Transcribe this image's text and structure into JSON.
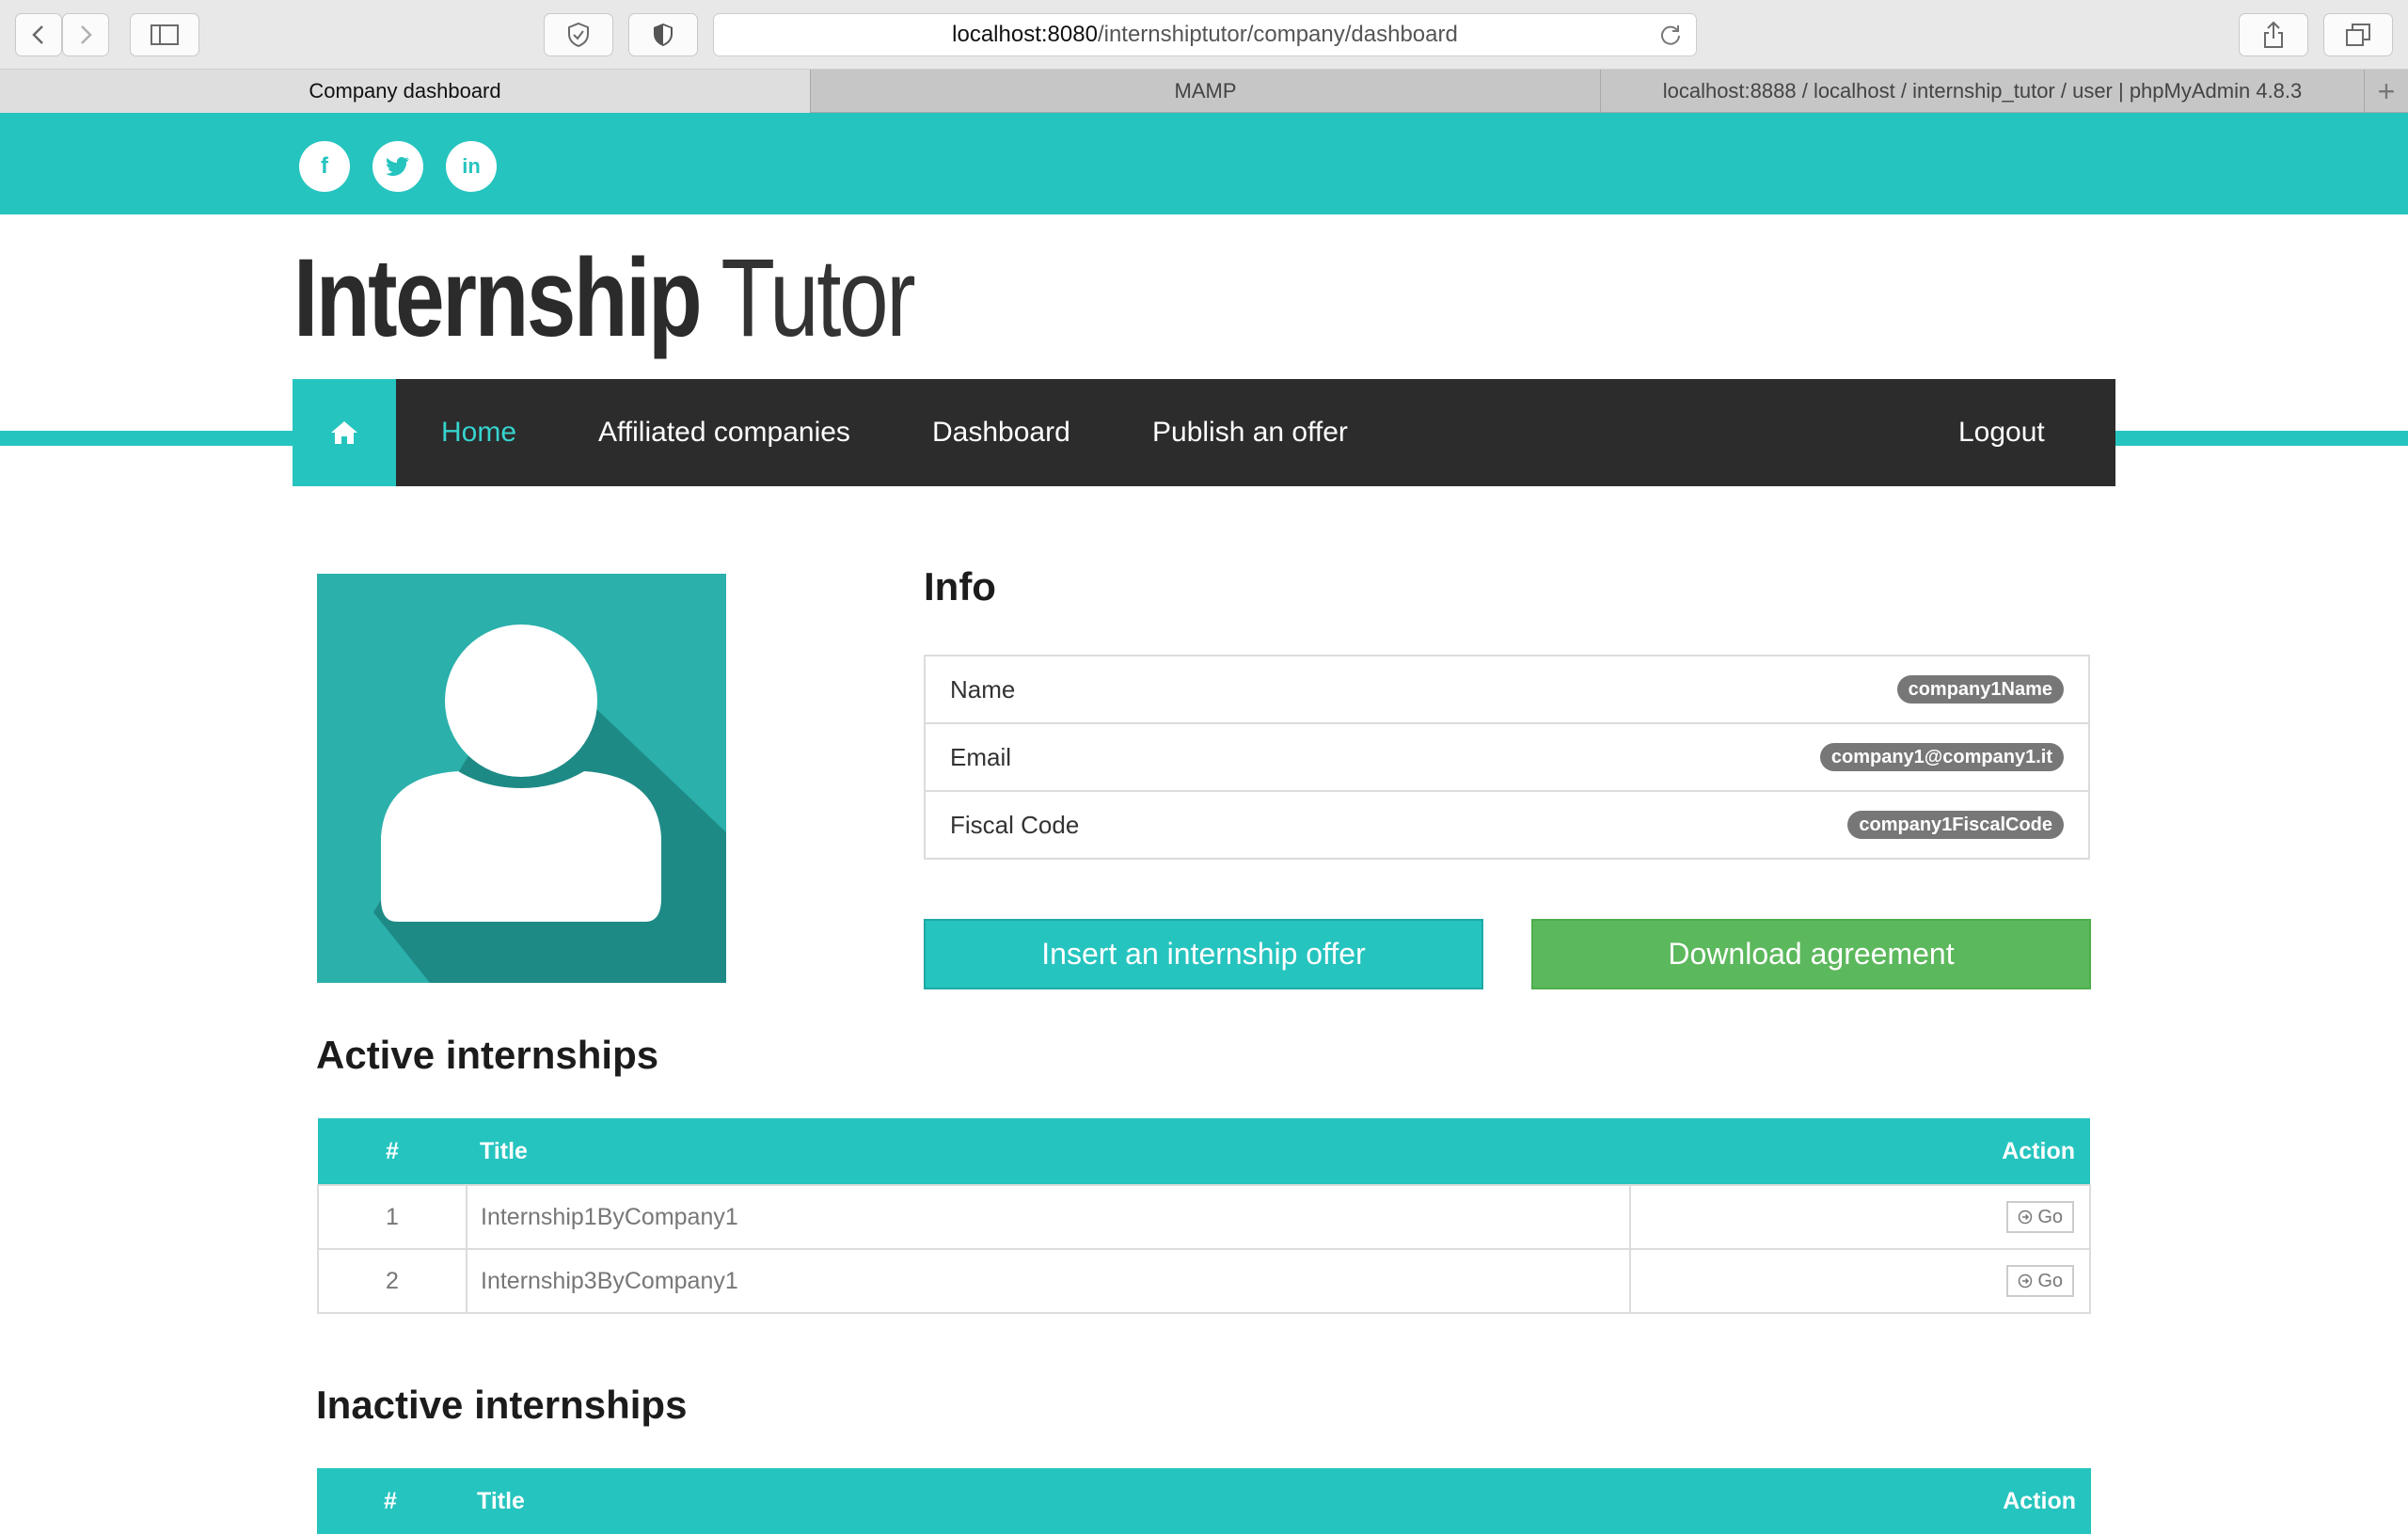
{
  "browser": {
    "url_host": "localhost:8080",
    "url_path": "/internshiptutor/company/dashboard",
    "tabs": [
      {
        "label": "Company dashboard"
      },
      {
        "label": "MAMP"
      },
      {
        "label": "localhost:8888 / localhost / internship_tutor / user | phpMyAdmin 4.8.3"
      }
    ],
    "new_tab_label": "+"
  },
  "social": {
    "facebook": "f",
    "twitter": "t",
    "linkedin": "in"
  },
  "logo": {
    "bold": "Internship",
    "light": "Tutor"
  },
  "nav": {
    "home_icon": "home-icon",
    "items": [
      {
        "label": "Home"
      },
      {
        "label": "Affiliated companies"
      },
      {
        "label": "Dashboard"
      },
      {
        "label": "Publish an offer"
      }
    ],
    "logout": "Logout"
  },
  "info": {
    "title": "Info",
    "rows": [
      {
        "label": "Name",
        "value": "company1Name"
      },
      {
        "label": "Email",
        "value": "company1@company1.it"
      },
      {
        "label": "Fiscal Code",
        "value": "company1FiscalCode"
      }
    ]
  },
  "actions": {
    "insert": "Insert an internship offer",
    "download": "Download agreement"
  },
  "active": {
    "title": "Active internships",
    "headers": {
      "num": "#",
      "title": "Title",
      "action": "Action"
    },
    "rows": [
      {
        "num": "1",
        "title": "Internship1ByCompany1",
        "action": "Go"
      },
      {
        "num": "2",
        "title": "Internship3ByCompany1",
        "action": "Go"
      }
    ]
  },
  "inactive": {
    "title": "Inactive internships",
    "headers": {
      "num": "#",
      "title": "Title",
      "action": "Action"
    }
  },
  "colors": {
    "accent": "#26c4bf",
    "nav_bg": "#2c2c2c",
    "success": "#5cb85c",
    "badge": "#777777"
  }
}
